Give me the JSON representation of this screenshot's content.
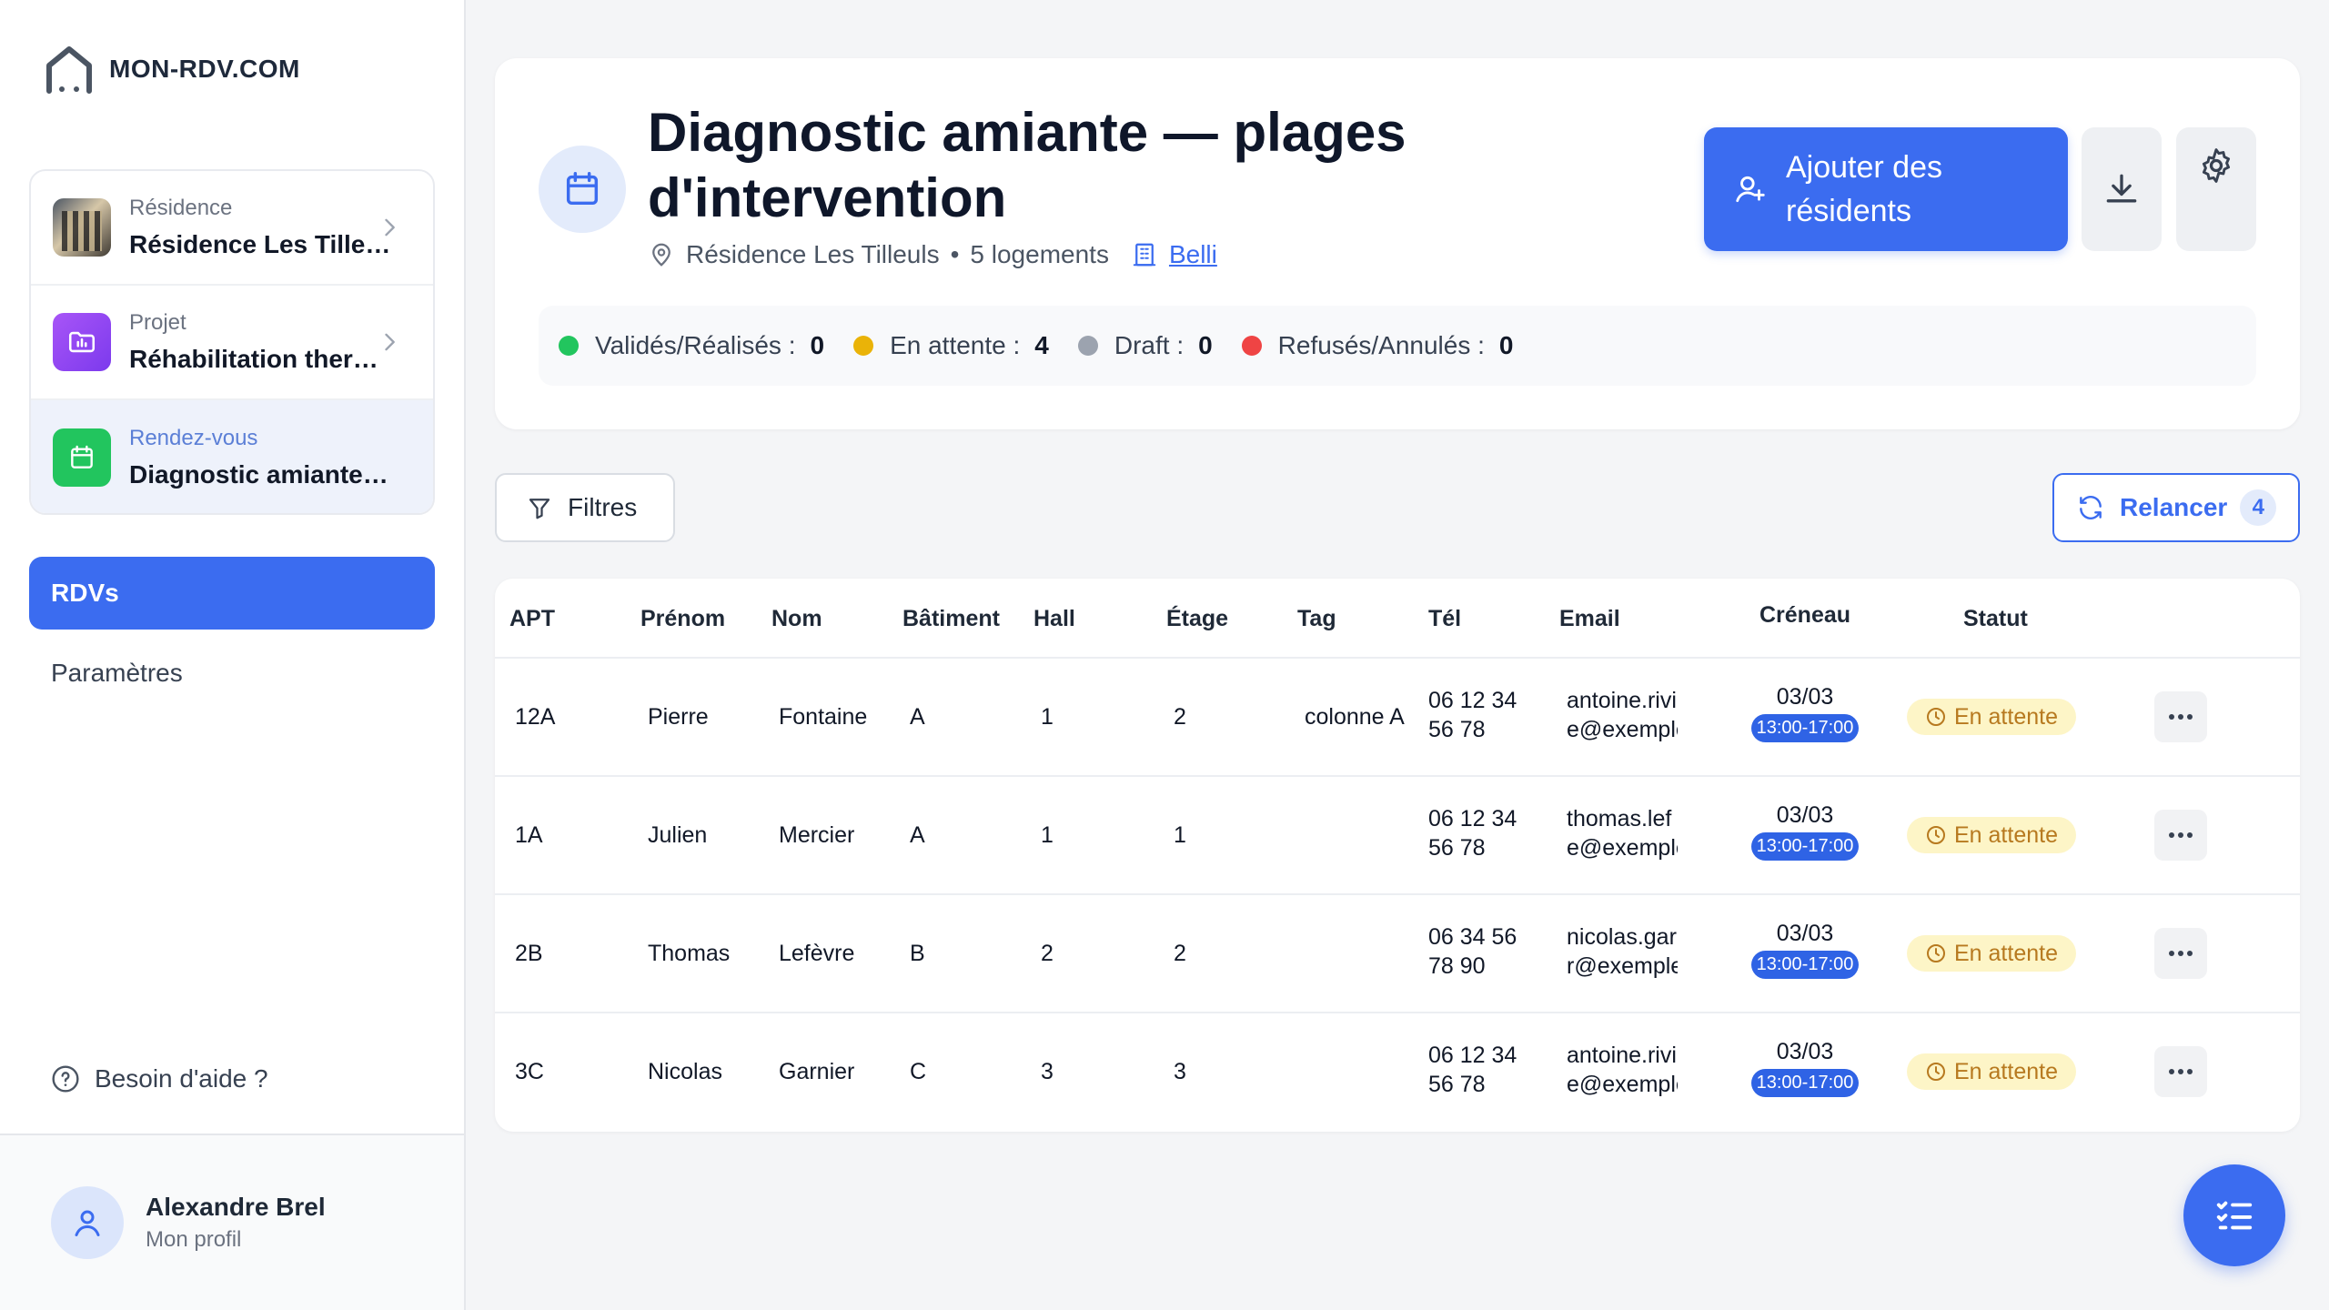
{
  "brand": {
    "name": "MON-RDV.COM",
    "logo_icon": "house-icon"
  },
  "context": [
    {
      "label": "Résidence",
      "value": "Résidence Les Tilleuls"
    },
    {
      "label": "Projet",
      "value": "Réhabilitation thermique"
    },
    {
      "label": "Rendez-vous",
      "value": "Diagnostic amiante — plages d'intervention"
    }
  ],
  "nav": {
    "items": [
      "RDVs",
      "Paramètres"
    ],
    "active": "RDVs"
  },
  "help": {
    "label": "Besoin d'aide ?"
  },
  "profile": {
    "name": "Alexandre Brel",
    "subtitle": "Mon profil"
  },
  "header": {
    "title": "Diagnostic amiante — plages d'intervention",
    "residence": "Résidence Les Tilleuls",
    "separator": "•",
    "units": "5 logements",
    "link": "Belli",
    "add_button": "Ajouter des résidents"
  },
  "stats": [
    {
      "label": "Validés/Réalisés :",
      "value": "0",
      "color": "#22c55e"
    },
    {
      "label": "En attente :",
      "value": "4",
      "color": "#eab308"
    },
    {
      "label": "Draft :",
      "value": "0",
      "color": "#9ca3af"
    },
    {
      "label": "Refusés/Annulés :",
      "value": "0",
      "color": "#ef4444"
    }
  ],
  "toolbar": {
    "filter_label": "Filtres",
    "relancer_label": "Relancer",
    "relancer_count": "4"
  },
  "table": {
    "columns": [
      "APT",
      "Prénom",
      "Nom",
      "Bâtiment",
      "Hall",
      "Étage",
      "Tag",
      "Tél",
      "Email",
      "Créneau",
      "Statut"
    ],
    "rows": [
      {
        "apt": "12A",
        "prenom": "Pierre",
        "nom": "Fontaine",
        "batiment": "A",
        "hall": "1",
        "etage": "2",
        "tag": "colonne A",
        "tel1": "06 12 34",
        "tel2": "56 78",
        "email1": "antoine.rivi",
        "email2": "e@exemple",
        "date": "03/03",
        "time": "13:00-17:00",
        "status": "En attente"
      },
      {
        "apt": "1A",
        "prenom": "Julien",
        "nom": "Mercier",
        "batiment": "A",
        "hall": "1",
        "etage": "1",
        "tag": "",
        "tel1": "06 12 34",
        "tel2": "56 78",
        "email1": "thomas.lef",
        "email2": "e@exemple",
        "date": "03/03",
        "time": "13:00-17:00",
        "status": "En attente"
      },
      {
        "apt": "2B",
        "prenom": "Thomas",
        "nom": "Lefèvre",
        "batiment": "B",
        "hall": "2",
        "etage": "2",
        "tag": "",
        "tel1": "06 34 56",
        "tel2": "78 90",
        "email1": "nicolas.gar",
        "email2": "r@exemple",
        "date": "03/03",
        "time": "13:00-17:00",
        "status": "En attente"
      },
      {
        "apt": "3C",
        "prenom": "Nicolas",
        "nom": "Garnier",
        "batiment": "C",
        "hall": "3",
        "etage": "3",
        "tag": "",
        "tel1": "06 12 34",
        "tel2": "56 78",
        "email1": "antoine.rivi",
        "email2": "e@exemple",
        "date": "03/03",
        "time": "13:00-17:00",
        "status": "En attente"
      }
    ]
  },
  "colors": {
    "primary": "#3b6cf0",
    "pending_bg": "#fdf5c7",
    "pending_text": "#b7791f"
  }
}
